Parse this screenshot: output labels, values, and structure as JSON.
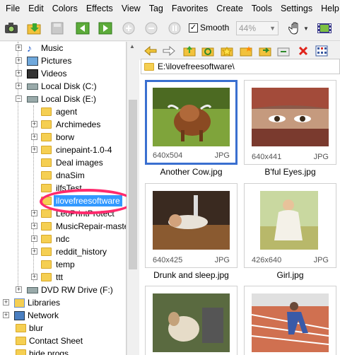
{
  "menu": [
    "File",
    "Edit",
    "Colors",
    "Effects",
    "View",
    "Tag",
    "Favorites",
    "Create",
    "Tools",
    "Settings",
    "Help"
  ],
  "toolbar": {
    "smooth_label": "Smooth",
    "smooth_checked": "✓",
    "zoom_value": "44%",
    "icons": [
      "camera-icon",
      "open-folder-icon",
      "save-icon",
      "prev-image-icon",
      "next-image-icon",
      "zoom-in-icon",
      "zoom-out-icon",
      "fit-icon",
      "hand-icon",
      "filmstrip-icon"
    ]
  },
  "tree": {
    "items": [
      {
        "label": "Music",
        "icon": "music-icon"
      },
      {
        "label": "Pictures",
        "icon": "pictures-icon"
      },
      {
        "label": "Videos",
        "icon": "videos-icon"
      },
      {
        "label": "Local Disk (C:)",
        "icon": "drive-icon"
      },
      {
        "label": "Local Disk (E:)",
        "icon": "drive-icon"
      },
      {
        "label": "agent",
        "icon": "folder-icon"
      },
      {
        "label": "Archimedes",
        "icon": "folder-icon"
      },
      {
        "label": "borw",
        "icon": "folder-icon"
      },
      {
        "label": "cinepaint-1.0-4",
        "icon": "folder-icon"
      },
      {
        "label": "Deal images",
        "icon": "folder-icon"
      },
      {
        "label": "dnaSim",
        "icon": "folder-icon"
      },
      {
        "label": "ilfsTest",
        "icon": "folder-icon"
      },
      {
        "label": "ilovefreesoftware",
        "icon": "folder-icon"
      },
      {
        "label": "LeoPrintProtect",
        "icon": "folder-icon"
      },
      {
        "label": "MusicRepair-master",
        "icon": "folder-icon"
      },
      {
        "label": "ndc",
        "icon": "folder-icon"
      },
      {
        "label": "reddit_history",
        "icon": "folder-icon"
      },
      {
        "label": "temp",
        "icon": "folder-icon"
      },
      {
        "label": "ttt",
        "icon": "folder-icon"
      },
      {
        "label": "DVD RW Drive (F:)",
        "icon": "dvd-icon"
      },
      {
        "label": "Libraries",
        "icon": "libraries-icon"
      },
      {
        "label": "Network",
        "icon": "network-icon"
      },
      {
        "label": "blur",
        "icon": "folder-icon"
      },
      {
        "label": "Contact Sheet",
        "icon": "folder-icon"
      },
      {
        "label": "hide progs",
        "icon": "folder-icon"
      }
    ],
    "selected": "ilovefreesoftware"
  },
  "browser": {
    "path": "E:\\ilovefreesoftware\\",
    "thumbnails": [
      {
        "name": "Another Cow.jpg",
        "dims": "640x504",
        "ext": "JPG"
      },
      {
        "name": "B'ful Eyes.jpg",
        "dims": "640x441",
        "ext": "JPG"
      },
      {
        "name": "Drunk and sleep.jpg",
        "dims": "640x425",
        "ext": "JPG"
      },
      {
        "name": "Girl.jpg",
        "dims": "426x640",
        "ext": "JPG"
      },
      {
        "name": "",
        "dims": "",
        "ext": ""
      },
      {
        "name": "",
        "dims": "",
        "ext": ""
      }
    ],
    "nav_icons": [
      "back-icon",
      "forward-icon",
      "up-folder-icon",
      "refresh-icon",
      "favorite-icon",
      "new-folder-icon",
      "copy-to-icon",
      "move-to-icon",
      "delete-icon",
      "thumbnail-view-icon"
    ]
  },
  "colors": {
    "selection": "#3399ff",
    "highlight_ring": "#ff2a6d",
    "card_selected": "#3a6fd0"
  }
}
